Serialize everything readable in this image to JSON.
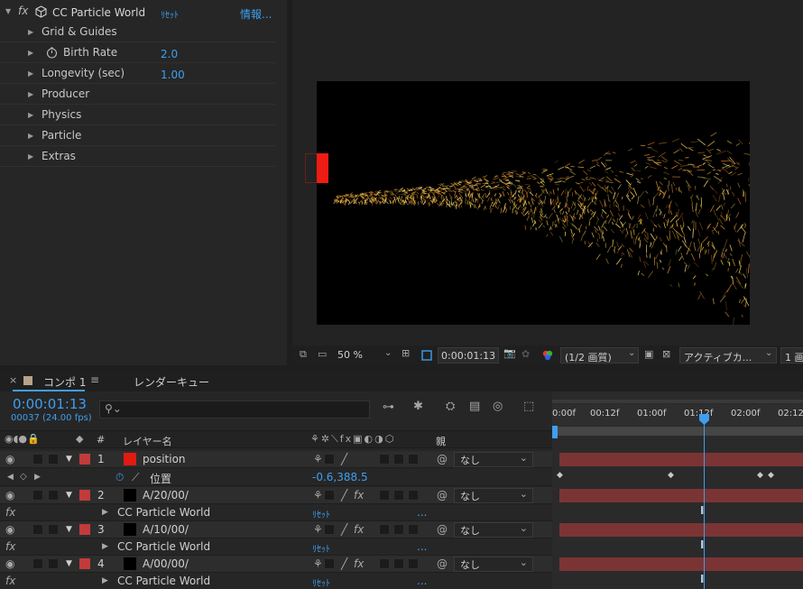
{
  "effect_controls": {
    "effect_name": "CC Particle World",
    "reset_label": "ﾘｾｯﾄ",
    "about_label": "情報...",
    "rows": [
      {
        "label": "Grid & Guides"
      },
      {
        "label": "Birth Rate",
        "value": "2.0"
      },
      {
        "label": "Longevity (sec)",
        "value": "1.00"
      },
      {
        "label": "Producer"
      },
      {
        "label": "Physics"
      },
      {
        "label": "Particle"
      },
      {
        "label": "Extras"
      }
    ]
  },
  "viewer": {
    "zoom": "50 %",
    "timecode": "0:00:01:13",
    "resolution": "(1/2 画質)",
    "camera": "アクティブカ...",
    "views": "1 画"
  },
  "timeline": {
    "tab_comp": "コンポ 1",
    "tab_render": "レンダーキュー",
    "timecode": "0:00:01:13",
    "frames": "00037 (24.00 fps)",
    "search_placeholder": "",
    "columns": {
      "num": "#",
      "layer_name": "レイヤー名",
      "parent": "親"
    },
    "ruler": [
      "0:00f",
      "00:12f",
      "01:00f",
      "01:12f",
      "02:00f",
      "02:12"
    ],
    "layers": [
      {
        "num": "1",
        "name": "position",
        "parent": "なし",
        "label_color": "#c23b3b",
        "swatch": "#e11b12"
      },
      {
        "num": "2",
        "name": "A/20/00/",
        "parent": "なし",
        "label_color": "#c23b3b",
        "swatch": "#000000"
      },
      {
        "num": "3",
        "name": "A/10/00/",
        "parent": "なし",
        "label_color": "#c23b3b",
        "swatch": "#000000"
      },
      {
        "num": "4",
        "name": "A/00/00/",
        "parent": "なし",
        "label_color": "#c23b3b",
        "swatch": "#000000"
      }
    ],
    "position_prop": {
      "label": "位置",
      "value": "-0.6,388.5"
    },
    "effect_rows": [
      {
        "name": "CC Particle World",
        "reset": "ﾘｾｯﾄ",
        "more": "..."
      },
      {
        "name": "CC Particle World",
        "reset": "ﾘｾｯﾄ",
        "more": "..."
      },
      {
        "name": "CC Particle World",
        "reset": "ﾘｾｯﾄ",
        "more": "..."
      }
    ],
    "accent": "#3e9ff0",
    "bar_color": "#7b3434"
  }
}
